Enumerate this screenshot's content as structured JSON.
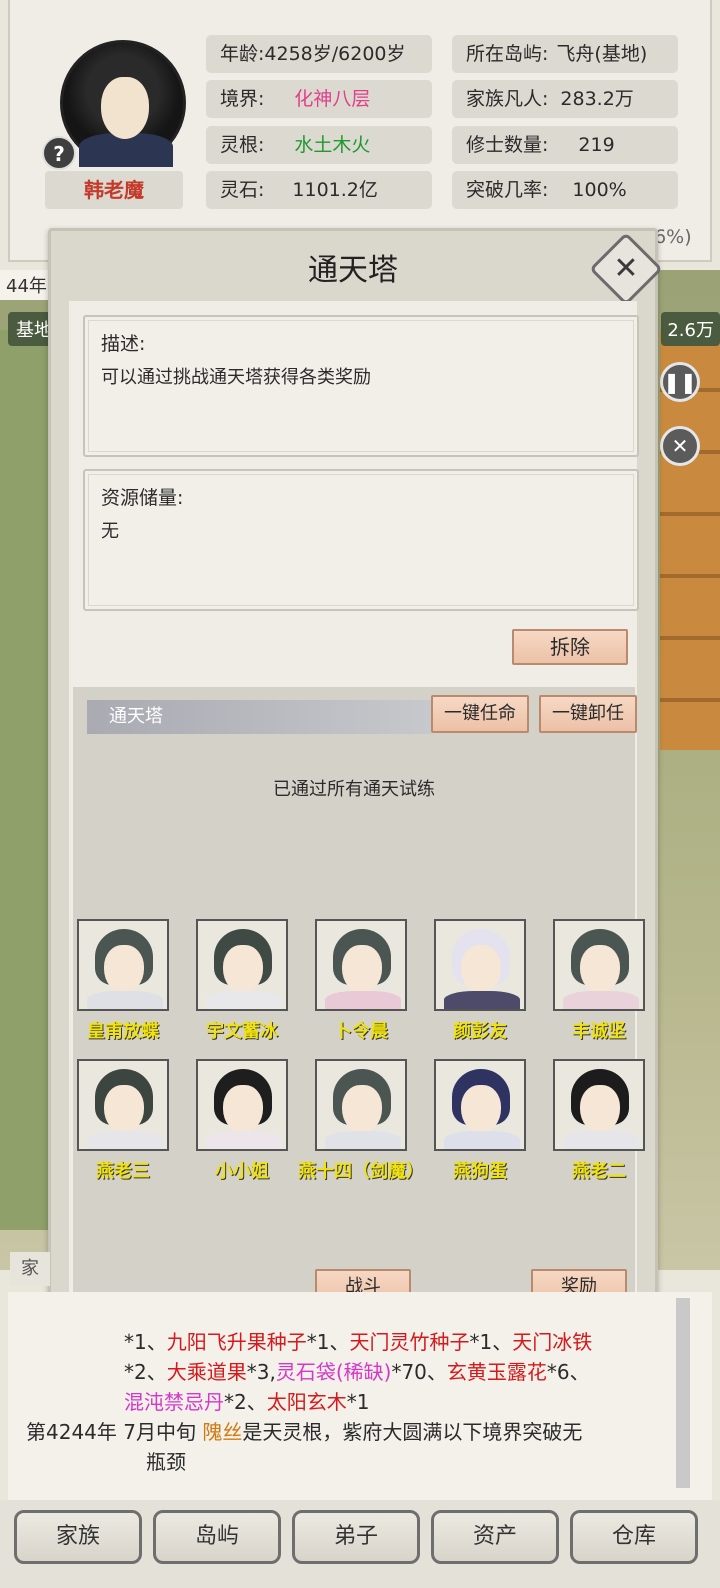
{
  "header": {
    "name": "韩老魔",
    "help_icon": "?",
    "stats": [
      {
        "label": "年龄:",
        "value": "4258岁/6200岁"
      },
      {
        "label": "所在岛屿:",
        "value": "飞舟(基地)"
      },
      {
        "label": "境界:",
        "value": "化神八层"
      },
      {
        "label": "家族凡人:",
        "value": "283.2万"
      },
      {
        "label": "灵根:",
        "value": "水土木火"
      },
      {
        "label": "修士数量:",
        "value": "219"
      },
      {
        "label": "灵石:",
        "value": "1101.2亿"
      },
      {
        "label": "突破几率:",
        "value": "100%"
      }
    ],
    "partial_right": "56%)"
  },
  "background": {
    "year_fragment": "44年",
    "base_fragment": "基地",
    "right_fragment": "2.6万"
  },
  "dialog": {
    "title": "通天塔",
    "close_symbol": "✕",
    "description_label": "描述:",
    "description_text": "可以通过挑战通天塔获得各类奖励",
    "resources_label": "资源储量:",
    "resources_text": "无",
    "demolish_button": "拆除",
    "tower_label": "通天塔",
    "appoint_all_button": "一键任命",
    "dismiss_all_button": "一键卸任",
    "status_text": "已通过所有通天试练",
    "members": [
      "皇甫放蝶",
      "宇文蓄冰",
      "卜令晨",
      "颜彭友",
      "丰诚坚",
      "燕老三",
      "小小姐",
      "燕十四（剑魔）",
      "燕狗蛋",
      "燕老二"
    ],
    "fight_button": "战斗",
    "reward_button": "奖励"
  },
  "log": {
    "family_tab": "家",
    "line1": [
      {
        "text": "*1、",
        "style": "plain"
      },
      {
        "text": "九阳飞升果种子",
        "style": "red"
      },
      {
        "text": "*1、",
        "style": "plain"
      },
      {
        "text": "天门灵竹种子",
        "style": "red"
      },
      {
        "text": "*1、",
        "style": "plain"
      },
      {
        "text": "天门冰铁",
        "style": "red"
      }
    ],
    "line2": [
      {
        "text": "*2、",
        "style": "plain"
      },
      {
        "text": "大乘道果",
        "style": "red"
      },
      {
        "text": "*3,",
        "style": "plain"
      },
      {
        "text": "灵石袋(稀缺)",
        "style": "magenta"
      },
      {
        "text": "*70、",
        "style": "plain"
      },
      {
        "text": "玄黄玉露花",
        "style": "red"
      },
      {
        "text": "*6、",
        "style": "plain"
      }
    ],
    "line3": [
      {
        "text": "混沌禁忌丹",
        "style": "magenta"
      },
      {
        "text": "*2、",
        "style": "plain"
      },
      {
        "text": "太阳玄木",
        "style": "red"
      },
      {
        "text": "*1",
        "style": "plain"
      }
    ],
    "line4": [
      {
        "text": "第4244年 7月中旬 ",
        "style": "plain"
      },
      {
        "text": "隗丝",
        "style": "orange"
      },
      {
        "text": "是天灵根，紫府大圆满以下境界突破无",
        "style": "plain"
      }
    ],
    "line5": "瓶颈"
  },
  "nav": [
    "家族",
    "岛屿",
    "弟子",
    "资产",
    "仓库"
  ]
}
